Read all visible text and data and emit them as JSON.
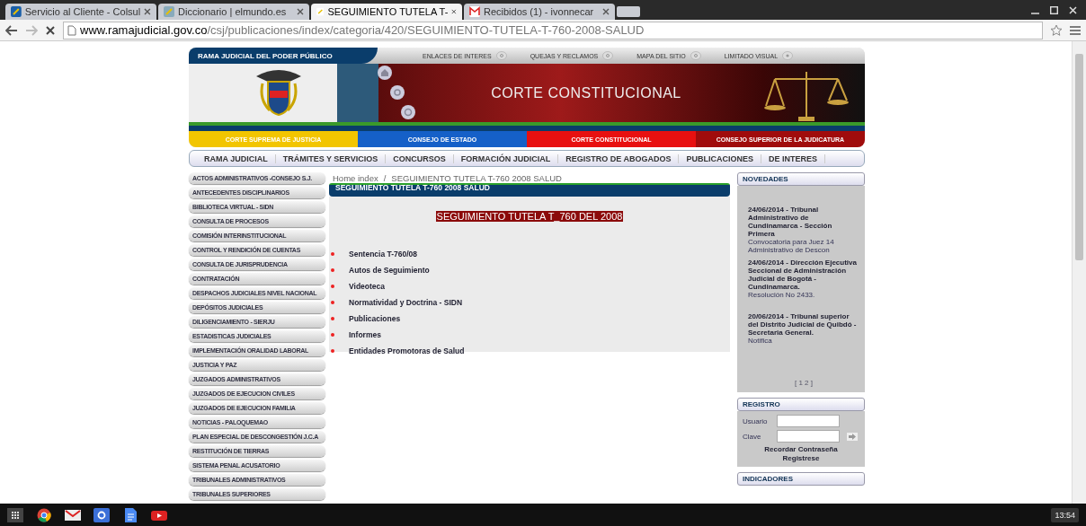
{
  "browser": {
    "tabs": [
      {
        "label": "Servicio al Cliente - Colsul",
        "selected": false
      },
      {
        "label": "Diccionario | elmundo.es",
        "selected": false
      },
      {
        "label": "SEGUIMIENTO TUTELA T-",
        "selected": true
      },
      {
        "label": "Recibidos (1) - ivonnecar",
        "selected": false
      }
    ],
    "url_host": "www.ramajudicial.gov.co",
    "url_path": "/csj/publicaciones/index/categoria/420/SEGUIMIENTO-TUTELA-T-760-2008-SALUD"
  },
  "header": {
    "title": "RAMA JUDICIAL DEL PODER PÚBLICO",
    "top_links": [
      "ENLACES DE INTERES",
      "QUEJAS Y RECLAMOS",
      "MAPA DEL SITIO",
      "LIMITADO VISUAL"
    ],
    "banner_title": "CORTE CONSTITUCIONAL",
    "bands": [
      {
        "label": "CORTE SUPREMA DE JUSTICIA",
        "color": "#f2c500"
      },
      {
        "label": "CONSEJO DE ESTADO",
        "color": "#1560c8"
      },
      {
        "label": "CORTE CONSTITUCIONAL",
        "color": "#e81010"
      },
      {
        "label": "CONSEJO SUPERIOR DE LA JUDICATURA",
        "color": "#a00c0c"
      }
    ]
  },
  "nav": [
    "RAMA JUDICIAL",
    "TRÁMITES Y SERVICIOS",
    "CONCURSOS",
    "FORMACIÓN JUDICIAL",
    "REGISTRO DE ABOGADOS",
    "PUBLICACIONES",
    "DE INTERES"
  ],
  "sidebar": [
    "ACTOS ADMINISTRATIVOS -CONSEJO S.J.",
    "ANTECEDENTES DISCIPLINARIOS",
    "BIBLIOTECA VIRTUAL - SIDN",
    "CONSULTA DE PROCESOS",
    "COMISIÓN INTERINSTITUCIONAL",
    "CONTROL Y RENDICIÓN DE CUENTAS",
    "CONSULTA DE JURISPRUDENCIA",
    "CONTRATACIÓN",
    "DESPACHOS JUDICIALES NIVEL NACIONAL",
    "DEPÓSITOS JUDICIALES",
    "DILIGENCIAMIENTO - SIERJU",
    "ESTADISTICAS JUDICIALES",
    "IMPLEMENTACIÓN ORALIDAD LABORAL",
    "JUSTICIA Y PAZ",
    "JUZGADOS ADMINISTRATIVOS",
    "JUZGADOS DE EJECUCION CIVILES",
    "JUZGADOS DE EJECUCION FAMILIA",
    "NOTICIAS - PALOQUEMAO",
    "PLAN ESPECIAL DE DESCONGESTIÓN J.C.A",
    "RESTITUCIÓN DE TIERRAS",
    "SISTEMA PENAL ACUSATORIO",
    "TRIBUNALES ADMINISTRATIVOS",
    "TRIBUNALES SUPERIORES"
  ],
  "main": {
    "breadcrumb": [
      "Home index",
      "/",
      "SEGUIMIENTO TUTELA T-760 2008 SALUD"
    ],
    "panel_title": "SEGUIMIENTO TUTELA T-760 2008 SALUD",
    "heading": "SEGUIMIENTO TUTELA T_760 DEL 2008",
    "links": [
      "Sentencia T-760/08",
      "Autos de Seguimiento",
      "Videoteca",
      "Normatividad y Doctrina - SIDN",
      "Publicaciones",
      "Informes",
      "Entidades Promotoras de Salud"
    ]
  },
  "novedades": {
    "title": "NOVEDADES",
    "items": [
      {
        "headline": "24/06/2014 - Tribunal Administrativo de Cundinamarca - Sección Primera",
        "summary": "Convocatoria para Juez 14 Administrativo de Descon"
      },
      {
        "headline": "24/06/2014 - Dirección Ejecutiva Seccional de Administración Judicial de Bogotá - Cundinamarca.",
        "summary": "Resolución No 2433."
      },
      {
        "headline": "20/06/2014 - Tribunal superior del Distrito Judicial de Quibdó - Secretaria General.",
        "summary": "Notifica"
      }
    ],
    "pager": "[ 1 2 ]"
  },
  "registro": {
    "title": "REGISTRO",
    "user_label": "Usuario",
    "password_label": "Clave",
    "links": [
      "Recordar Contraseña",
      "Registrese"
    ]
  },
  "indicadores": {
    "title": "INDICADORES"
  },
  "taskbar": {
    "clock": "13:54"
  }
}
